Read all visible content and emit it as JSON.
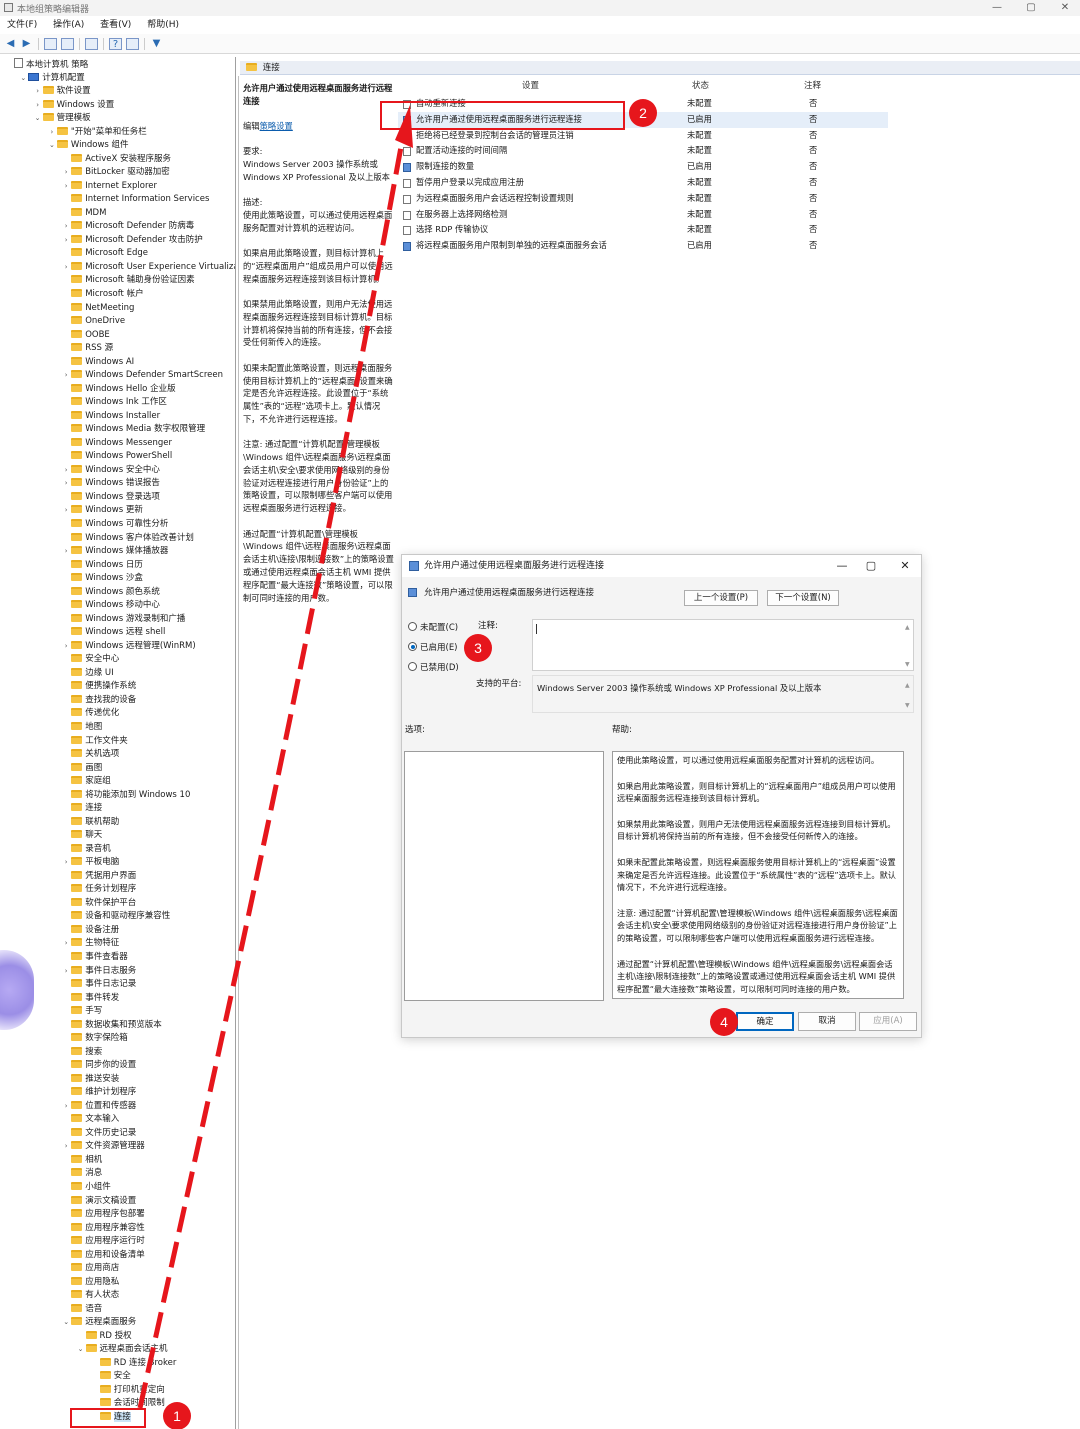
{
  "window": {
    "title": "本地组策略编辑器",
    "min": "—",
    "max": "▢",
    "close": "✕"
  },
  "menu": [
    "文件(F)",
    "操作(A)",
    "查看(V)",
    "帮助(H)"
  ],
  "tree": [
    {
      "label": "本地计算机 策略",
      "indent": 0,
      "chev": "",
      "icon": "doc"
    },
    {
      "label": "计算机配置",
      "indent": 1,
      "chev": "v",
      "icon": "pc"
    },
    {
      "label": "软件设置",
      "indent": 2,
      "chev": ">",
      "icon": "folder"
    },
    {
      "label": "Windows 设置",
      "indent": 2,
      "chev": ">",
      "icon": "folder"
    },
    {
      "label": "管理模板",
      "indent": 2,
      "chev": "v",
      "icon": "folder"
    },
    {
      "label": "\"开始\"菜单和任务栏",
      "indent": 3,
      "chev": ">",
      "icon": "folder"
    },
    {
      "label": "Windows 组件",
      "indent": 3,
      "chev": "v",
      "icon": "folder"
    },
    {
      "label": "ActiveX 安装程序服务",
      "indent": 4,
      "chev": "",
      "icon": "folder"
    },
    {
      "label": "BitLocker 驱动器加密",
      "indent": 4,
      "chev": ">",
      "icon": "folder"
    },
    {
      "label": "Internet Explorer",
      "indent": 4,
      "chev": ">",
      "icon": "folder"
    },
    {
      "label": "Internet Information Services",
      "indent": 4,
      "chev": "",
      "icon": "folder"
    },
    {
      "label": "MDM",
      "indent": 4,
      "chev": "",
      "icon": "folder"
    },
    {
      "label": "Microsoft Defender 防病毒",
      "indent": 4,
      "chev": ">",
      "icon": "folder"
    },
    {
      "label": "Microsoft Defender 攻击防护",
      "indent": 4,
      "chev": ">",
      "icon": "folder"
    },
    {
      "label": "Microsoft Edge",
      "indent": 4,
      "chev": "",
      "icon": "folder"
    },
    {
      "label": "Microsoft User Experience Virtualiza",
      "indent": 4,
      "chev": ">",
      "icon": "folder"
    },
    {
      "label": "Microsoft 辅助身份验证因素",
      "indent": 4,
      "chev": "",
      "icon": "folder"
    },
    {
      "label": "Microsoft 帐户",
      "indent": 4,
      "chev": "",
      "icon": "folder"
    },
    {
      "label": "NetMeeting",
      "indent": 4,
      "chev": "",
      "icon": "folder"
    },
    {
      "label": "OneDrive",
      "indent": 4,
      "chev": "",
      "icon": "folder"
    },
    {
      "label": "OOBE",
      "indent": 4,
      "chev": "",
      "icon": "folder"
    },
    {
      "label": "RSS 源",
      "indent": 4,
      "chev": "",
      "icon": "folder"
    },
    {
      "label": "Windows AI",
      "indent": 4,
      "chev": "",
      "icon": "folder"
    },
    {
      "label": "Windows Defender SmartScreen",
      "indent": 4,
      "chev": ">",
      "icon": "folder"
    },
    {
      "label": "Windows Hello 企业版",
      "indent": 4,
      "chev": "",
      "icon": "folder"
    },
    {
      "label": "Windows Ink 工作区",
      "indent": 4,
      "chev": "",
      "icon": "folder"
    },
    {
      "label": "Windows Installer",
      "indent": 4,
      "chev": "",
      "icon": "folder"
    },
    {
      "label": "Windows Media 数字权限管理",
      "indent": 4,
      "chev": "",
      "icon": "folder"
    },
    {
      "label": "Windows Messenger",
      "indent": 4,
      "chev": "",
      "icon": "folder"
    },
    {
      "label": "Windows PowerShell",
      "indent": 4,
      "chev": "",
      "icon": "folder"
    },
    {
      "label": "Windows 安全中心",
      "indent": 4,
      "chev": ">",
      "icon": "folder"
    },
    {
      "label": "Windows 错误报告",
      "indent": 4,
      "chev": ">",
      "icon": "folder"
    },
    {
      "label": "Windows 登录选项",
      "indent": 4,
      "chev": "",
      "icon": "folder"
    },
    {
      "label": "Windows 更新",
      "indent": 4,
      "chev": ">",
      "icon": "folder"
    },
    {
      "label": "Windows 可靠性分析",
      "indent": 4,
      "chev": "",
      "icon": "folder"
    },
    {
      "label": "Windows 客户体验改善计划",
      "indent": 4,
      "chev": "",
      "icon": "folder"
    },
    {
      "label": "Windows 媒体播放器",
      "indent": 4,
      "chev": ">",
      "icon": "folder"
    },
    {
      "label": "Windows 日历",
      "indent": 4,
      "chev": "",
      "icon": "folder"
    },
    {
      "label": "Windows 沙盒",
      "indent": 4,
      "chev": "",
      "icon": "folder"
    },
    {
      "label": "Windows 颜色系统",
      "indent": 4,
      "chev": "",
      "icon": "folder"
    },
    {
      "label": "Windows 移动中心",
      "indent": 4,
      "chev": "",
      "icon": "folder"
    },
    {
      "label": "Windows 游戏录制和广播",
      "indent": 4,
      "chev": "",
      "icon": "folder"
    },
    {
      "label": "Windows 远程 shell",
      "indent": 4,
      "chev": "",
      "icon": "folder"
    },
    {
      "label": "Windows 远程管理(WinRM)",
      "indent": 4,
      "chev": ">",
      "icon": "folder"
    },
    {
      "label": "安全中心",
      "indent": 4,
      "chev": "",
      "icon": "folder"
    },
    {
      "label": "边缘 UI",
      "indent": 4,
      "chev": "",
      "icon": "folder"
    },
    {
      "label": "便携操作系统",
      "indent": 4,
      "chev": "",
      "icon": "folder"
    },
    {
      "label": "查找我的设备",
      "indent": 4,
      "chev": "",
      "icon": "folder"
    },
    {
      "label": "传递优化",
      "indent": 4,
      "chev": "",
      "icon": "folder"
    },
    {
      "label": "地图",
      "indent": 4,
      "chev": "",
      "icon": "folder"
    },
    {
      "label": "工作文件夹",
      "indent": 4,
      "chev": "",
      "icon": "folder"
    },
    {
      "label": "关机选项",
      "indent": 4,
      "chev": "",
      "icon": "folder"
    },
    {
      "label": "画图",
      "indent": 4,
      "chev": "",
      "icon": "folder"
    },
    {
      "label": "家庭组",
      "indent": 4,
      "chev": "",
      "icon": "folder"
    },
    {
      "label": "将功能添加到 Windows 10",
      "indent": 4,
      "chev": "",
      "icon": "folder"
    },
    {
      "label": "连接",
      "indent": 4,
      "chev": "",
      "icon": "folder"
    },
    {
      "label": "联机帮助",
      "indent": 4,
      "chev": "",
      "icon": "folder"
    },
    {
      "label": "聊天",
      "indent": 4,
      "chev": "",
      "icon": "folder"
    },
    {
      "label": "录音机",
      "indent": 4,
      "chev": "",
      "icon": "folder"
    },
    {
      "label": "平板电脑",
      "indent": 4,
      "chev": ">",
      "icon": "folder"
    },
    {
      "label": "凭据用户界面",
      "indent": 4,
      "chev": "",
      "icon": "folder"
    },
    {
      "label": "任务计划程序",
      "indent": 4,
      "chev": "",
      "icon": "folder"
    },
    {
      "label": "软件保护平台",
      "indent": 4,
      "chev": "",
      "icon": "folder"
    },
    {
      "label": "设备和驱动程序兼容性",
      "indent": 4,
      "chev": "",
      "icon": "folder"
    },
    {
      "label": "设备注册",
      "indent": 4,
      "chev": "",
      "icon": "folder"
    },
    {
      "label": "生物特征",
      "indent": 4,
      "chev": ">",
      "icon": "folder"
    },
    {
      "label": "事件查看器",
      "indent": 4,
      "chev": "",
      "icon": "folder"
    },
    {
      "label": "事件日志服务",
      "indent": 4,
      "chev": ">",
      "icon": "folder"
    },
    {
      "label": "事件日志记录",
      "indent": 4,
      "chev": "",
      "icon": "folder"
    },
    {
      "label": "事件转发",
      "indent": 4,
      "chev": "",
      "icon": "folder"
    },
    {
      "label": "手写",
      "indent": 4,
      "chev": "",
      "icon": "folder"
    },
    {
      "label": "数据收集和预览版本",
      "indent": 4,
      "chev": "",
      "icon": "folder"
    },
    {
      "label": "数字保险箱",
      "indent": 4,
      "chev": "",
      "icon": "folder"
    },
    {
      "label": "搜索",
      "indent": 4,
      "chev": "",
      "icon": "folder"
    },
    {
      "label": "同步你的设置",
      "indent": 4,
      "chev": "",
      "icon": "folder"
    },
    {
      "label": "推送安装",
      "indent": 4,
      "chev": "",
      "icon": "folder"
    },
    {
      "label": "维护计划程序",
      "indent": 4,
      "chev": "",
      "icon": "folder"
    },
    {
      "label": "位置和传感器",
      "indent": 4,
      "chev": ">",
      "icon": "folder"
    },
    {
      "label": "文本输入",
      "indent": 4,
      "chev": "",
      "icon": "folder"
    },
    {
      "label": "文件历史记录",
      "indent": 4,
      "chev": "",
      "icon": "folder"
    },
    {
      "label": "文件资源管理器",
      "indent": 4,
      "chev": ">",
      "icon": "folder"
    },
    {
      "label": "相机",
      "indent": 4,
      "chev": "",
      "icon": "folder"
    },
    {
      "label": "消息",
      "indent": 4,
      "chev": "",
      "icon": "folder"
    },
    {
      "label": "小组件",
      "indent": 4,
      "chev": "",
      "icon": "folder"
    },
    {
      "label": "演示文稿设置",
      "indent": 4,
      "chev": "",
      "icon": "folder"
    },
    {
      "label": "应用程序包部署",
      "indent": 4,
      "chev": "",
      "icon": "folder"
    },
    {
      "label": "应用程序兼容性",
      "indent": 4,
      "chev": "",
      "icon": "folder"
    },
    {
      "label": "应用程序运行时",
      "indent": 4,
      "chev": "",
      "icon": "folder"
    },
    {
      "label": "应用和设备清单",
      "indent": 4,
      "chev": "",
      "icon": "folder"
    },
    {
      "label": "应用商店",
      "indent": 4,
      "chev": "",
      "icon": "folder"
    },
    {
      "label": "应用隐私",
      "indent": 4,
      "chev": "",
      "icon": "folder"
    },
    {
      "label": "有人状态",
      "indent": 4,
      "chev": "",
      "icon": "folder"
    },
    {
      "label": "语音",
      "indent": 4,
      "chev": "",
      "icon": "folder"
    },
    {
      "label": "远程桌面服务",
      "indent": 4,
      "chev": "v",
      "icon": "folder"
    },
    {
      "label": "RD 授权",
      "indent": 5,
      "chev": "",
      "icon": "folder"
    },
    {
      "label": "远程桌面会话主机",
      "indent": 5,
      "chev": "v",
      "icon": "folder"
    },
    {
      "label": "RD 连接 Broker",
      "indent": 6,
      "chev": "",
      "icon": "folder"
    },
    {
      "label": "安全",
      "indent": 6,
      "chev": "",
      "icon": "folder"
    },
    {
      "label": "打印机重定向",
      "indent": 6,
      "chev": "",
      "icon": "folder"
    },
    {
      "label": "会话时间限制",
      "indent": 6,
      "chev": "",
      "icon": "folder"
    },
    {
      "label": "连接",
      "indent": 6,
      "chev": "",
      "icon": "folder",
      "selected": true
    }
  ],
  "pane": {
    "header": "连接",
    "desc_title": "允许用户通过使用远程桌面服务进行远程连接",
    "edit_prefix": "编辑",
    "edit_link": "策略设置",
    "requirements": "要求:\nWindows Server 2003 操作系统或 Windows XP Professional 及以上版本",
    "description": "描述:\n使用此策略设置，可以通过使用远程桌面服务配置对计算机的远程访问。",
    "p_enabled": "如果启用此策略设置，则目标计算机上的“远程桌面用户”组成员用户可以使用远程桌面服务远程连接到该目标计算机。",
    "p_disabled": "如果禁用此策略设置，则用户无法使用远程桌面服务远程连接到目标计算机。目标计算机将保持当前的所有连接，但不会接受任何新传入的连接。",
    "p_notconfig": "如果未配置此策略设置，则远程桌面服务使用目标计算机上的“远程桌面”设置来确定是否允许远程连接。此设置位于“系统属性”表的“远程”选项卡上。默认情况下，不允许进行远程连接。",
    "p_note": "注意: 通过配置“计算机配置\\管理模板\\Windows 组件\\远程桌面服务\\远程桌面会话主机\\安全\\要求使用网络级别的身份验证对远程连接进行用户身份验证”上的策略设置，可以限制哪些客户端可以使用远程桌面服务进行远程连接。",
    "p_limit": "通过配置“计算机配置\\管理模板\\Windows 组件\\远程桌面服务\\远程桌面会话主机\\连接\\限制连接数”上的策略设置或通过使用远程桌面会话主机 WMI 提供程序配置“最大连接数”策略设置，可以限制可同时连接的用户数。"
  },
  "settings": {
    "headers": {
      "name": "设置",
      "state": "状态",
      "comment": "注释"
    },
    "rows": [
      {
        "name": "自动重新连接",
        "state": "未配置",
        "comment": "否",
        "enabled": false
      },
      {
        "name": "允许用户通过使用远程桌面服务进行远程连接",
        "state": "已启用",
        "comment": "否",
        "enabled": true,
        "selected": true
      },
      {
        "name": "拒绝将已经登录到控制台会话的管理员注销",
        "state": "未配置",
        "comment": "否",
        "enabled": false
      },
      {
        "name": "配置活动连接的时间间隔",
        "state": "未配置",
        "comment": "否",
        "enabled": false
      },
      {
        "name": "限制连接的数量",
        "state": "已启用",
        "comment": "否",
        "enabled": true
      },
      {
        "name": "暂停用户登录以完成应用注册",
        "state": "未配置",
        "comment": "否",
        "enabled": false
      },
      {
        "name": "为远程桌面服务用户会话远程控制设置规则",
        "state": "未配置",
        "comment": "否",
        "enabled": false
      },
      {
        "name": "在服务器上选择网络检测",
        "state": "未配置",
        "comment": "否",
        "enabled": false
      },
      {
        "name": "选择 RDP 传输协议",
        "state": "未配置",
        "comment": "否",
        "enabled": false
      },
      {
        "name": "将远程桌面服务用户限制到单独的远程桌面服务会话",
        "state": "已启用",
        "comment": "否",
        "enabled": true
      }
    ]
  },
  "dialog": {
    "title": "允许用户通过使用远程桌面服务进行远程连接",
    "subtitle": "允许用户通过使用远程桌面服务进行远程连接",
    "prev": "上一个设置(P)",
    "next": "下一个设置(N)",
    "radio_notconfig": "未配置(C)",
    "radio_enabled": "已启用(E)",
    "radio_disabled": "已禁用(D)",
    "comment_label": "注释:",
    "platform_label": "支持的平台:",
    "platform_value": "Windows Server 2003 操作系统或 Windows XP Professional 及以上版本",
    "options_label": "选项:",
    "help_label": "帮助:",
    "help": [
      "使用此策略设置，可以通过使用远程桌面服务配置对计算机的远程访问。",
      "如果启用此策略设置，则目标计算机上的“远程桌面用户”组成员用户可以使用远程桌面服务远程连接到该目标计算机。",
      "如果禁用此策略设置，则用户无法使用远程桌面服务远程连接到目标计算机。目标计算机将保持当前的所有连接，但不会接受任何新传入的连接。",
      "如果未配置此策略设置，则远程桌面服务使用目标计算机上的“远程桌面”设置来确定是否允许远程连接。此设置位于“系统属性”表的“远程”选项卡上。默认情况下，不允许进行远程连接。",
      "注意: 通过配置“计算机配置\\管理模板\\Windows 组件\\远程桌面服务\\远程桌面会话主机\\安全\\要求使用网络级别的身份验证对远程连接进行用户身份验证”上的策略设置，可以限制哪些客户端可以使用远程桌面服务进行远程连接。",
      "通过配置“计算机配置\\管理模板\\Windows 组件\\远程桌面服务\\远程桌面会话主机\\连接\\限制连接数”上的策略设置或通过使用远程桌面会话主机 WMI 提供程序配置“最大连接数”策略设置，可以限制可同时连接的用户数。"
    ],
    "ok": "确定",
    "cancel": "取消",
    "apply": "应用(A)"
  },
  "annotations": {
    "step1": "1",
    "step2": "2",
    "step3": "3",
    "step4": "4",
    "color": "#e6161c"
  }
}
